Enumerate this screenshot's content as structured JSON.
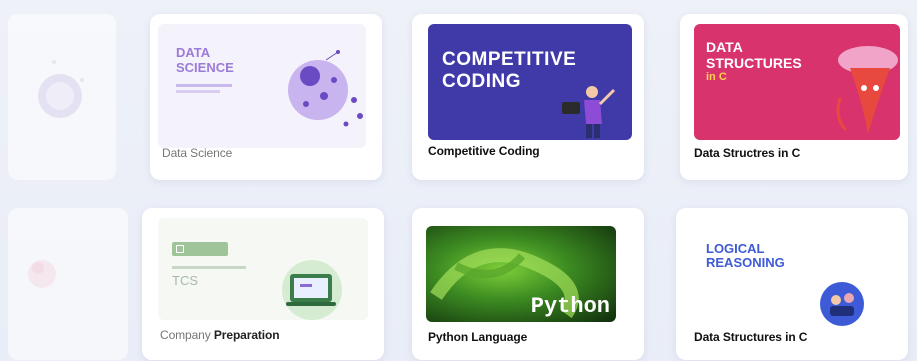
{
  "colors": {
    "page_bg": "#eef1f8",
    "ds_purple": "#9b7bd8",
    "cc_bg": "#3f3aa8",
    "dsc_bg": "#d9336e",
    "lr_blue": "#3d5bd6",
    "python_green": "#2e8b2e"
  },
  "row1": [
    {
      "label": "Data Science",
      "thumb_title_line1": "DATA",
      "thumb_title_line2": "SCIENCE",
      "icon": "virus-blob-illustration"
    },
    {
      "label": "Competitive Coding",
      "thumb_title_line1": "COMPETITIVE",
      "thumb_title_line2": "CODING",
      "icon": "coder-illustration"
    },
    {
      "label": "Data Structres in C",
      "thumb_title_line1": "DATA",
      "thumb_title_line2": "STRUCTURES",
      "thumb_title_line3": "in C",
      "icon": "character-illustration"
    }
  ],
  "row2": [
    {
      "label_prefix": "Company ",
      "label_strong": "Preparation",
      "thumb_title": "TCS",
      "icon": "laptop-illustration"
    },
    {
      "label": "Python Language",
      "thumb_title": "Python",
      "icon": "snake-photo"
    },
    {
      "label_prefix": "Data Structures in ",
      "label_strong": "C",
      "thumb_title_line1": "LOGICAL",
      "thumb_title_line2": "REASONING",
      "icon": "people-circle-illustration"
    }
  ]
}
